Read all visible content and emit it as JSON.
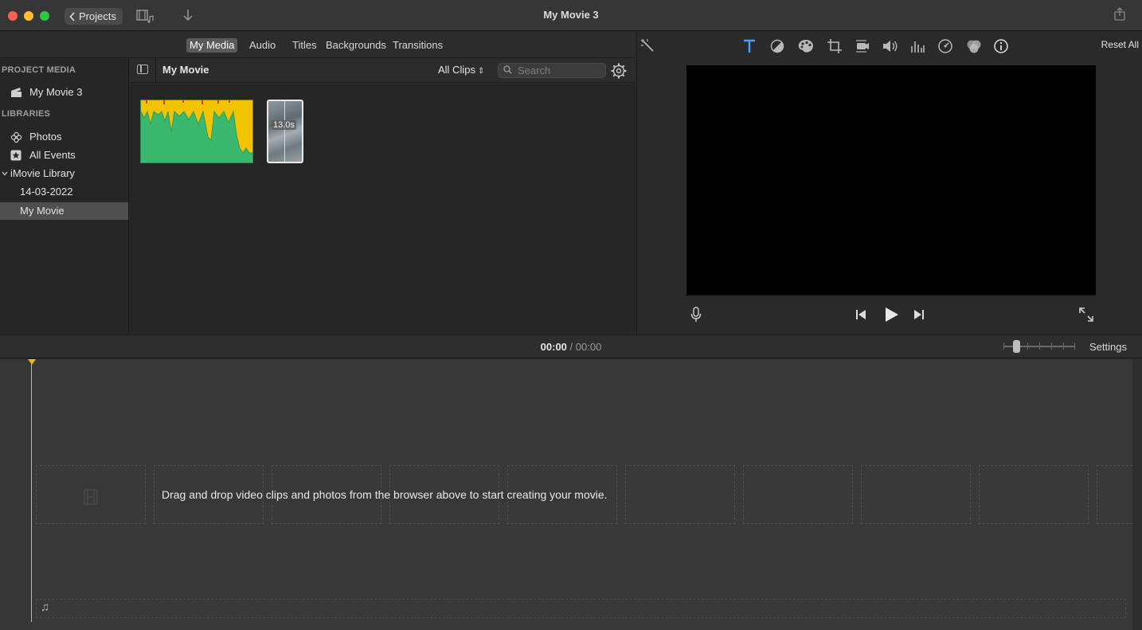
{
  "window": {
    "title": "My Movie 3"
  },
  "titlebar": {
    "projects_label": "Projects",
    "icons": [
      "media-layout-icon",
      "import-down-icon",
      "share-icon"
    ]
  },
  "browser_tabs": [
    {
      "label": "My Media",
      "active": true
    },
    {
      "label": "Audio",
      "active": false
    },
    {
      "label": "Titles",
      "active": false
    },
    {
      "label": "Backgrounds",
      "active": false
    },
    {
      "label": "Transitions",
      "active": false
    }
  ],
  "sidebar": {
    "project_media_heading": "PROJECT MEDIA",
    "project_item": "My Movie 3",
    "libraries_heading": "LIBRARIES",
    "items": [
      {
        "label": "Photos",
        "icon": "photos-icon"
      },
      {
        "label": "All Events",
        "icon": "star-icon"
      },
      {
        "label": "iMovie Library",
        "icon": "disclosure-down-icon"
      },
      {
        "label": "14-03-2022",
        "icon": ""
      },
      {
        "label": "My Movie",
        "icon": "",
        "selected": true
      }
    ]
  },
  "media_browser": {
    "title": "My Movie",
    "filter": "All Clips",
    "search_placeholder": "Search",
    "clips": [
      {
        "kind": "audio",
        "colors": {
          "body": "#3ab86d",
          "peaks": "#f2c400"
        }
      },
      {
        "kind": "video",
        "duration": "13.0s"
      }
    ]
  },
  "viewer": {
    "reset_all": "Reset All",
    "tools": [
      "magic-wand-icon",
      "titles-icon",
      "color-balance-icon",
      "color-correction-icon",
      "crop-icon",
      "stabilization-icon",
      "volume-icon",
      "noise-eq-icon",
      "speed-icon",
      "clip-filter-icon",
      "info-icon"
    ],
    "active_tool": "titles-icon",
    "accent": "#4a9eff"
  },
  "timeline": {
    "current_time": "00:00",
    "separator": "/",
    "total_time": "00:00",
    "settings_label": "Settings",
    "empty_hint": "Drag and drop video clips and photos from the browser above to start creating your movie.",
    "playhead_color": "#e1c200"
  }
}
